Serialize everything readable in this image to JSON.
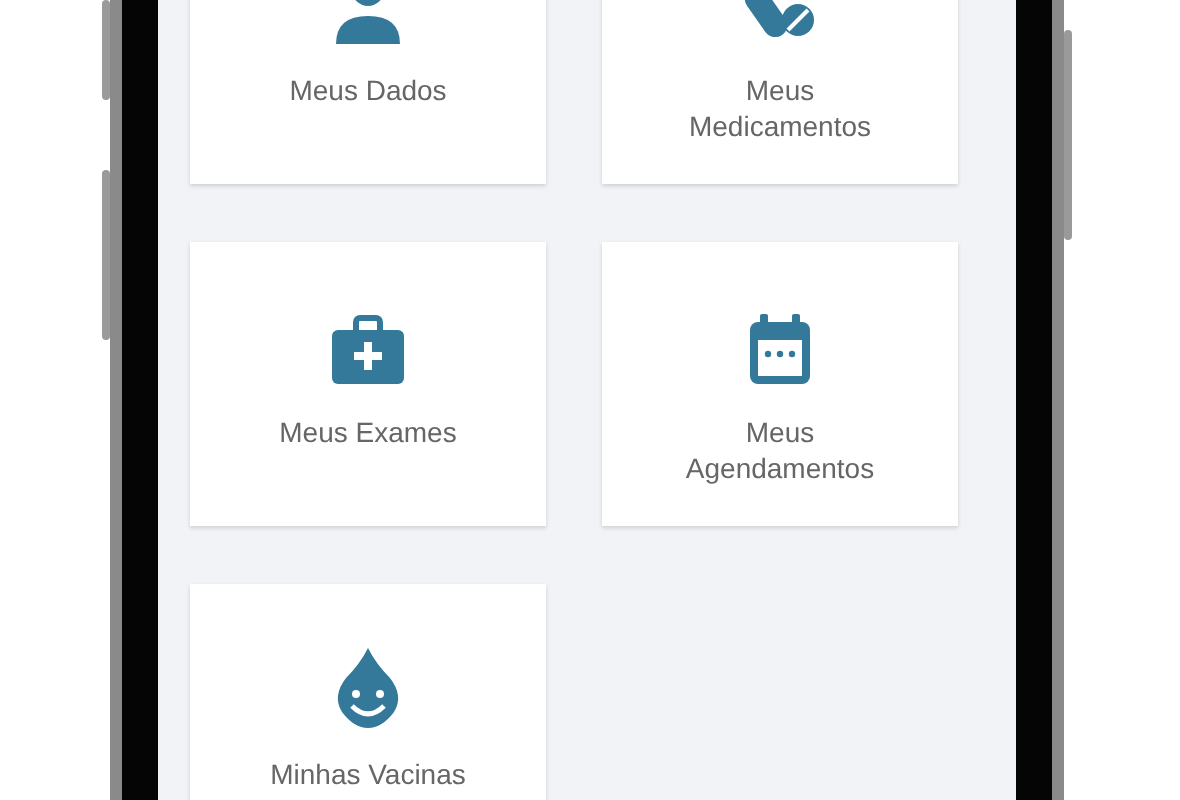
{
  "menu": [
    {
      "label": "Meus Dados",
      "kind": "person"
    },
    {
      "label": "Meus\nMedicamentos",
      "kind": "pills"
    },
    {
      "label": "Meus Exames",
      "kind": "kit"
    },
    {
      "label": "Meus\nAgendamentos",
      "kind": "calendar"
    },
    {
      "label": "Minhas Vacinas",
      "kind": "drop"
    }
  ]
}
